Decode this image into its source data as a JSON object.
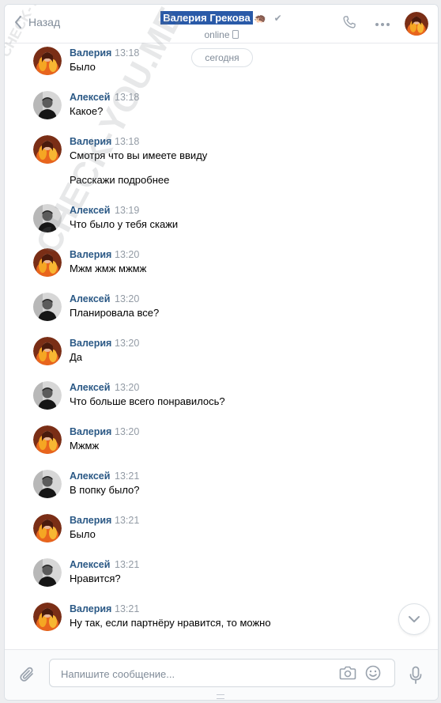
{
  "header": {
    "back_label": "Назад",
    "contact_name": "Валерия Грекова",
    "name_emoji": "🦔",
    "status": "online"
  },
  "date_separator": "сегодня",
  "messages": [
    {
      "author": "Валерия",
      "time": "13:18",
      "text": "Было",
      "avatar": "valeria"
    },
    {
      "author": "Алексей",
      "time": "13:18",
      "text": "Какое?",
      "avatar": "alexey"
    },
    {
      "author": "Валерия",
      "time": "13:18",
      "text": "Смотря что вы имеете ввиду",
      "text2": "Расскажи подробнее",
      "avatar": "valeria"
    },
    {
      "author": "Алексей",
      "time": "13:19",
      "text": "Что было у тебя скажи",
      "avatar": "alexey"
    },
    {
      "author": "Валерия",
      "time": "13:20",
      "text": "Мжм жмж мжмж",
      "avatar": "valeria"
    },
    {
      "author": "Алексей",
      "time": "13:20",
      "text": "Планировала все?",
      "avatar": "alexey"
    },
    {
      "author": "Валерия",
      "time": "13:20",
      "text": "Да",
      "avatar": "valeria"
    },
    {
      "author": "Алексей",
      "time": "13:20",
      "text": "Что больше всего понравилось?",
      "avatar": "alexey"
    },
    {
      "author": "Валерия",
      "time": "13:20",
      "text": "Мжмж",
      "avatar": "valeria"
    },
    {
      "author": "Алексей",
      "time": "13:21",
      "text": "В попку было?",
      "avatar": "alexey"
    },
    {
      "author": "Валерия",
      "time": "13:21",
      "text": "Было",
      "avatar": "valeria"
    },
    {
      "author": "Алексей",
      "time": "13:21",
      "text": "Нравится?",
      "avatar": "alexey"
    },
    {
      "author": "Валерия",
      "time": "13:21",
      "text": "Ну так, если партнёру нравится, то можно",
      "avatar": "valeria"
    }
  ],
  "composer": {
    "placeholder": "Напишите сообщение..."
  },
  "watermark": "CHECK-YOU.ME",
  "colors": {
    "accent": "#2a5885",
    "selection": "#2a5aa8",
    "muted": "#818c99"
  },
  "icons": [
    "chevron-left-icon",
    "phone-icon",
    "more-icon",
    "paperclip-icon",
    "camera-icon",
    "smile-icon",
    "microphone-icon",
    "chevron-down-icon"
  ]
}
